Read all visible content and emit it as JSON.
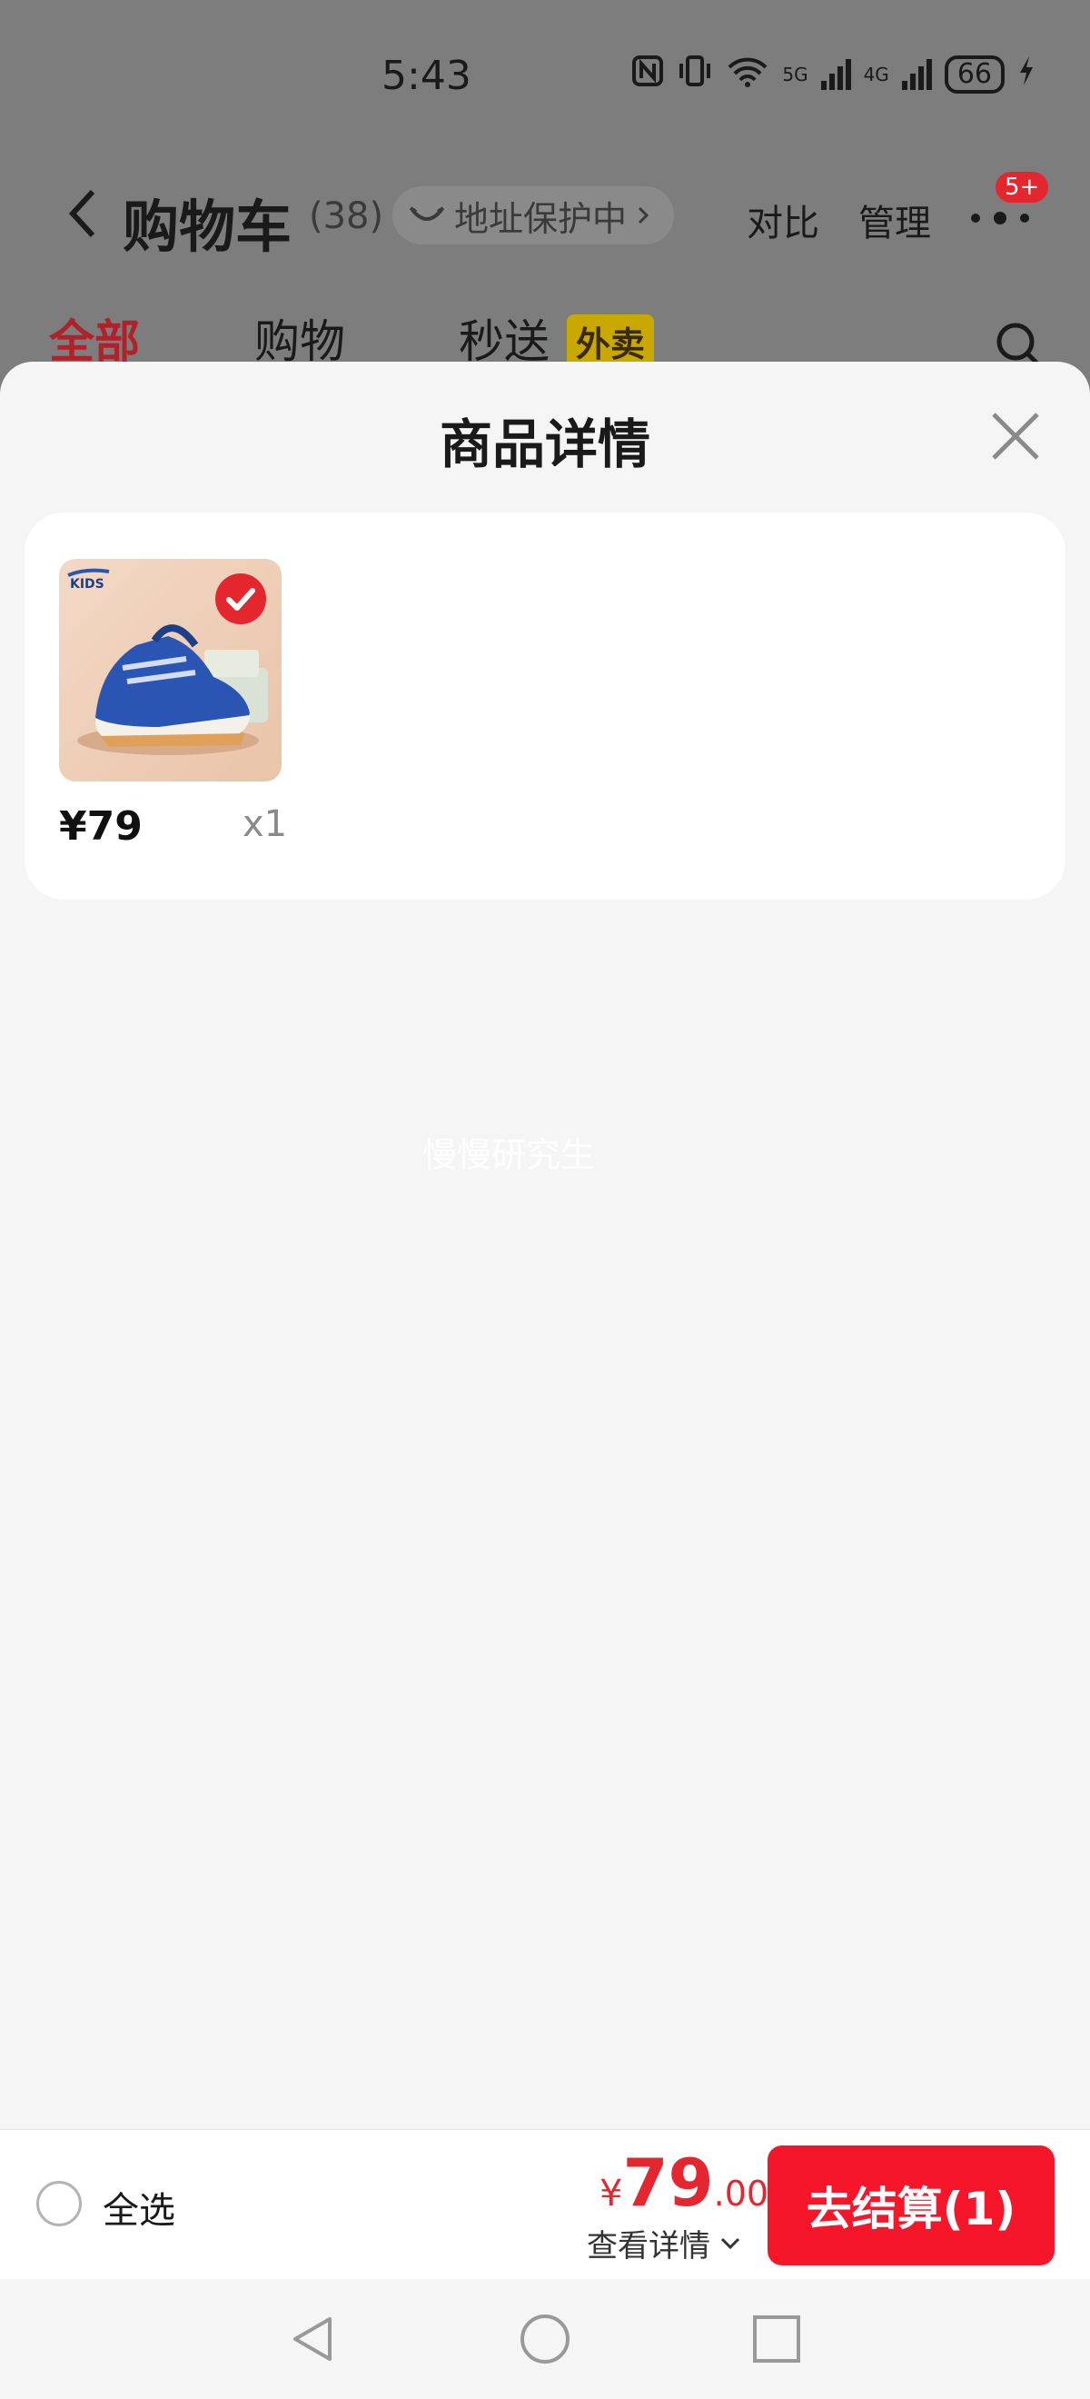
{
  "status_bar": {
    "time": "5:43",
    "network_wifi": "6",
    "network_5g": "5G",
    "network_4g": "4G",
    "battery": "66"
  },
  "header": {
    "title": "购物车",
    "count": "(38)",
    "address_protection": "地址保护中",
    "compare": "对比",
    "manage": "管理",
    "more_badge": "5+"
  },
  "tabs": [
    {
      "label": "全部",
      "active": true
    },
    {
      "label": "购物",
      "active": false
    },
    {
      "label": "秒送",
      "active": false,
      "badge": "外卖"
    }
  ],
  "sheet": {
    "title": "商品详情",
    "items": [
      {
        "price": "¥79",
        "quantity": "x1",
        "checked": true,
        "brand_mark": "KIDS"
      }
    ],
    "watermark": "慢慢研究生"
  },
  "bottom_bar": {
    "select_all": "全选",
    "currency": "¥",
    "total_integer": "79",
    "total_decimal": ".00",
    "view_detail": "查看详情",
    "checkout": "去结算(1)"
  },
  "colors": {
    "accent": "#f5162a",
    "price_red": "#e4262f",
    "overlay": "#7d7d7d",
    "sheet_bg": "#f5f5f5"
  }
}
